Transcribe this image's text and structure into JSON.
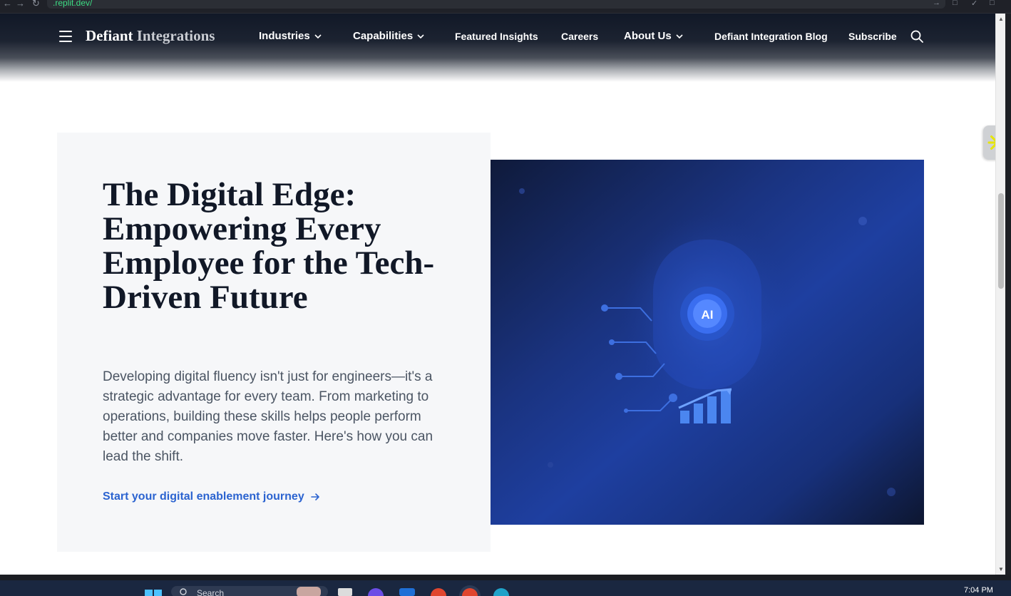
{
  "browser": {
    "url": ".replit.dev/"
  },
  "header": {
    "logo_part1": "Defiant",
    "logo_part2": "Integrations",
    "nav": {
      "industries": "Industries",
      "capabilities": "Capabilities",
      "featured_insights": "Featured Insights",
      "careers": "Careers",
      "about_us": "About Us",
      "blog": "Defiant Integration Blog",
      "subscribe": "Subscribe"
    }
  },
  "hero": {
    "title": "The Digital Edge: Empowering Every Employee for the Tech-Driven Future",
    "description": "Developing digital fluency isn't just for engineers—it's a strategic advantage for every team. From marketing to operations, building these skills helps people perform better and companies move faster. Here's how you can lead the shift.",
    "cta": "Start your digital enablement journey",
    "image_badge": "AI"
  },
  "taskbar": {
    "search_placeholder": "Search",
    "clock": "7:04 PM"
  },
  "colors": {
    "accent_link": "#2b63d0",
    "header_dark": "#111827",
    "hero_panel_bg": "#f6f7f9",
    "image_blue": "#1e3fa0",
    "side_widget_star": "#e6e600"
  },
  "icons": {
    "menu": "hamburger-menu-icon",
    "search": "magnifier-search-icon",
    "chevron": "chevron-down-icon",
    "cta_arrow": "arrow-right-icon",
    "side_widget": "asterisk-star-icon"
  }
}
